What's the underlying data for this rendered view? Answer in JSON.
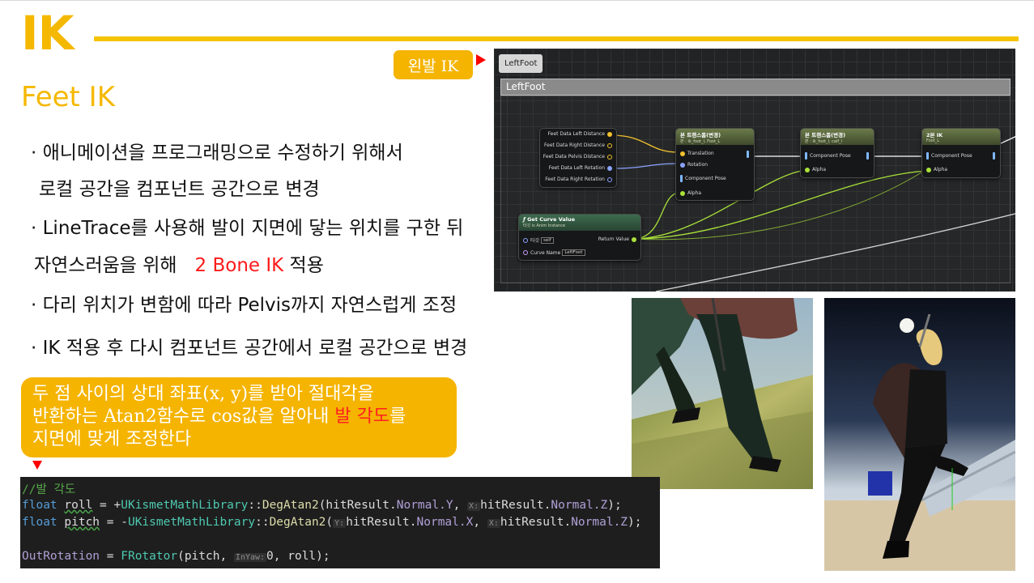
{
  "title": "IK",
  "subtitle": "Feet IK",
  "bullets": {
    "b1_line1": "· 애니메이션을 프로그래밍으로 수정하기 위해서",
    "b1_line2": "로컬 공간을 컴포넌트 공간으로 변경",
    "b2_line1": "· LineTrace를 사용해 발이 지면에 닿는 위치를 구한 뒤",
    "b2_line2_a": "자연스러움을 위해",
    "b2_line2_hl": "2 Bone IK",
    "b2_line2_b": "적용",
    "b3": "· 다리 위치가 변함에 따라 Pelvis까지 자연스럽게 조정",
    "b4": "· IK 적용 후 다시 컴포넌트 공간에서 로컬 공간으로 변경"
  },
  "callout": {
    "line1": "두 점 사이의 상대 좌표(x, y)를 받아 절대각을",
    "line2_a": "반환하는 Atan2함수로 cos값을 알아내",
    "line2_hl": "발 각도",
    "line2_b": "를",
    "line3": "지면에 맞게 조정한다"
  },
  "badge": "왼발 IK",
  "blueprint": {
    "tab": "LeftFoot",
    "comment": "LeftFoot",
    "struct_pins": [
      "Feet Data Left Distance",
      "Feet Data Right Distance",
      "Feet Data Pelvis Distance",
      "Feet Data Left Rotation",
      "Feet Data Right Rotation"
    ],
    "node1": {
      "title": "본 트랜스폼(변경)",
      "sub": "본 : ik_foot_l, Foot_L",
      "pins": [
        "Translation",
        "Rotation",
        "Component Pose",
        "Alpha"
      ]
    },
    "node2": {
      "title": "본 트랜스폼(변경)",
      "sub": "본 : ik_foot_l, calf_l",
      "pins": [
        "Component Pose",
        "Alpha"
      ]
    },
    "node3": {
      "title": "2본 IK",
      "sub": "Foot_L",
      "pins": [
        "Component Pose",
        "Alpha"
      ]
    },
    "curve": {
      "title": "Get Curve Value",
      "sub": "타깃 is Anim Instance",
      "target_label": "타깃",
      "target_value": "self",
      "return_label": "Return Value",
      "curve_label": "Curve Name",
      "curve_value": "LeftFoot"
    }
  },
  "code": {
    "comment": "//발 각도",
    "line1": {
      "kw": "float",
      "var": "roll",
      "eq": " = +",
      "cls": "UKismetMathLibrary",
      "fn": "DegAtan2",
      "a1": "hitResult.",
      "m1": "Normal.Y",
      "hint": "X:",
      "a2": "hitResult.",
      "m2": "Normal.Z"
    },
    "line2": {
      "kw": "float",
      "var": "pitch",
      "eq": " = -",
      "cls": "UKismetMathLibrary",
      "fn": "DegAtan2",
      "hint1": "Y:",
      "a1": "hitResult.",
      "m1": "Normal.X",
      "hint": "X:",
      "a2": "hitResult.",
      "m2": "Normal.Z"
    },
    "line3": {
      "var": "OutRotation",
      "eq": " = ",
      "cls": "FRotator",
      "a1": "pitch, ",
      "hint": "InYaw:",
      "a2": "0, roll);"
    }
  }
}
